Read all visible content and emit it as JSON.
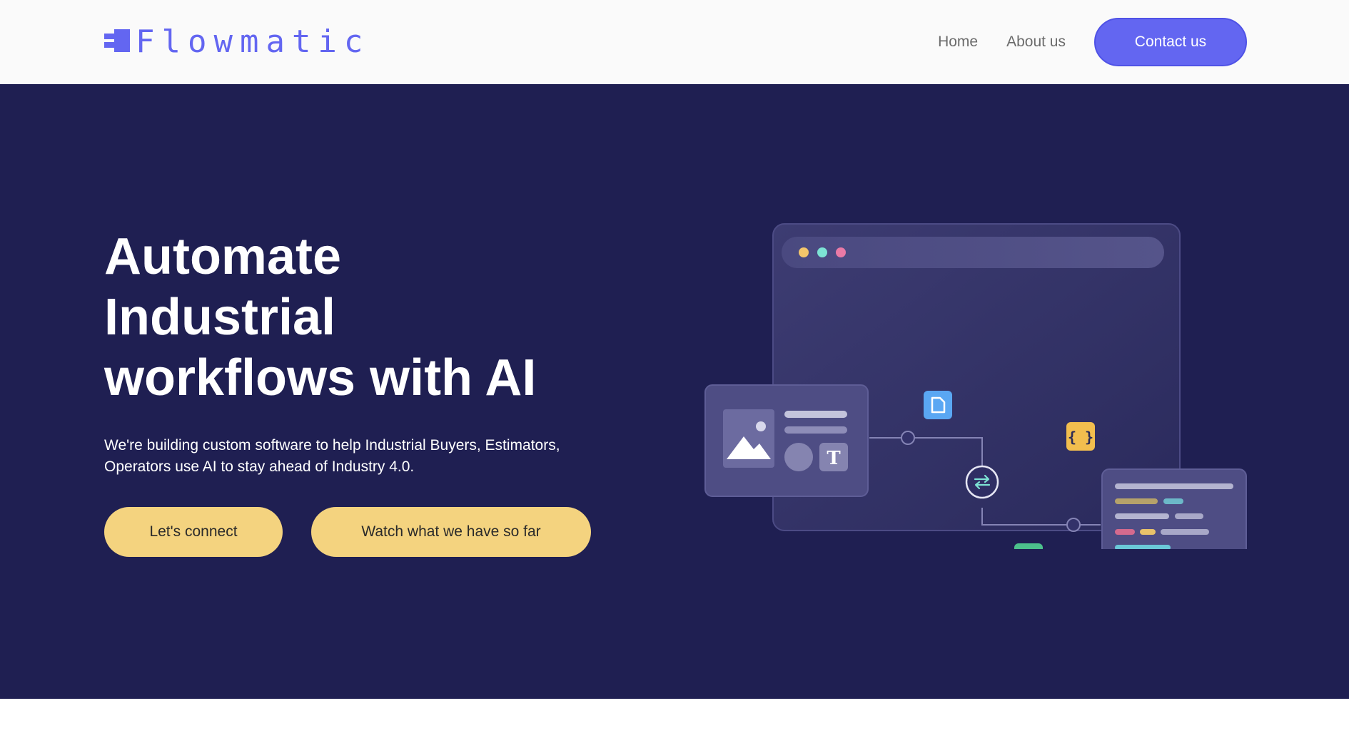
{
  "header": {
    "logo_text": "Flowmatic",
    "logo_icon": "flowmatic-logo-mark",
    "nav": {
      "home": "Home",
      "about": "About us",
      "contact": "Contact us"
    }
  },
  "hero": {
    "title_line1": "Automate",
    "title_line2": "Industrial",
    "title_line3": "workflows with AI",
    "subtitle_line1": "We're building custom software to help Industrial Buyers, Estimators,",
    "subtitle_line2": "Operators use AI to stay ahead of Industry 4.0.",
    "cta_primary": "Let's connect",
    "cta_secondary": "Watch what we have so far"
  },
  "illustration": {
    "icons": [
      "document-icon",
      "curly-braces-icon",
      "sync-icon",
      "code-brackets-icon",
      "image-icon",
      "text-format-icon"
    ],
    "braces_glyph": "{ }",
    "text_glyph": "T"
  },
  "colors": {
    "brand": "#6366f1",
    "hero_bg": "#1f1f52",
    "cta_yellow": "#f4d37f",
    "header_bg": "#fafafa"
  }
}
